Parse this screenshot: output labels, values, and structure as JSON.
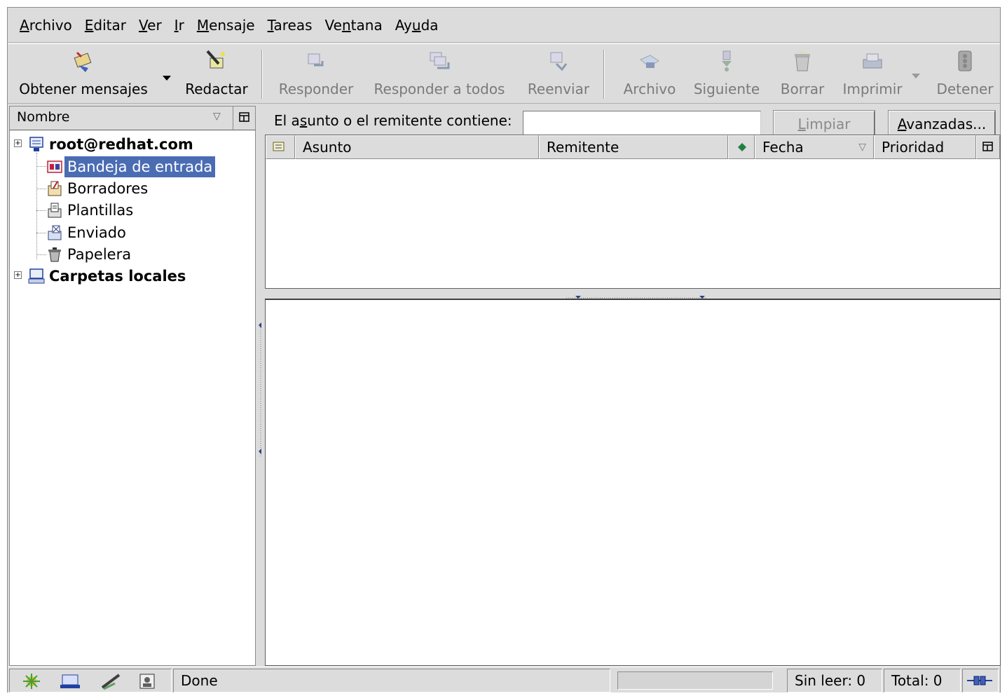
{
  "menu": [
    {
      "pre": "",
      "u": "A",
      "post": "rchivo"
    },
    {
      "pre": "",
      "u": "E",
      "post": "ditar"
    },
    {
      "pre": "",
      "u": "V",
      "post": "er"
    },
    {
      "pre": "",
      "u": "I",
      "post": "r"
    },
    {
      "pre": "",
      "u": "M",
      "post": "ensaje"
    },
    {
      "pre": "",
      "u": "T",
      "post": "areas"
    },
    {
      "pre": "Ve",
      "u": "n",
      "post": "tana"
    },
    {
      "pre": "Ay",
      "u": "u",
      "post": "da"
    }
  ],
  "toolbar": {
    "get_messages": "Obtener mensajes",
    "compose": "Redactar",
    "reply": "Responder",
    "reply_all": "Responder a todos",
    "forward": "Reenviar",
    "file": "Archivo",
    "next": "Siguiente",
    "delete": "Borrar",
    "print": "Imprimir",
    "stop": "Detener"
  },
  "folders": {
    "header": "Nombre",
    "accounts": [
      {
        "label": "root@redhat.com",
        "icon": "mail-account-icon"
      },
      {
        "label": "Carpetas locales",
        "icon": "local-folders-icon"
      }
    ],
    "items": [
      {
        "label": "Bandeja de entrada",
        "icon": "inbox-icon",
        "selected": true
      },
      {
        "label": "Borradores",
        "icon": "drafts-icon"
      },
      {
        "label": "Plantillas",
        "icon": "templates-icon"
      },
      {
        "label": "Enviado",
        "icon": "sent-icon"
      },
      {
        "label": "Papelera",
        "icon": "trash-icon"
      }
    ]
  },
  "search": {
    "label_pre": "El a",
    "label_u": "s",
    "label_post": "unto o el remitente contiene:",
    "value": "",
    "clear_u": "L",
    "clear_post": "impiar",
    "advanced_u": "A",
    "advanced_post": "vanzadas..."
  },
  "columns": {
    "subject": "Asunto",
    "sender": "Remitente",
    "date": "Fecha",
    "priority": "Prioridad"
  },
  "status": {
    "text": "Done",
    "unread": "Sin leer: 0",
    "total": "Total: 0"
  },
  "colors": {
    "selection": "#4a6cb3",
    "chrome": "#dcdcdc"
  }
}
